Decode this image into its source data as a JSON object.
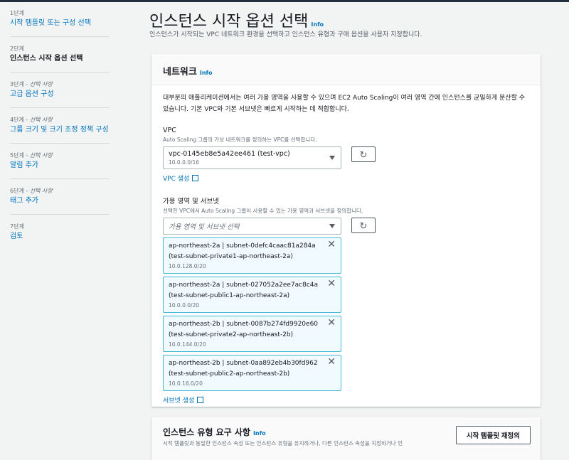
{
  "steps": [
    {
      "num": "1단계",
      "opt": "",
      "title": "시작 템플릿 또는 구성 선택"
    },
    {
      "num": "2단계",
      "opt": "",
      "title": "인스턴스 시작 옵션 선택"
    },
    {
      "num": "3단계",
      "opt": " - 선택 사항",
      "title": "고급 옵션 구성"
    },
    {
      "num": "4단계",
      "opt": " - 선택 사항",
      "title": "그룹 크기 및 크기 조정 정책 구성"
    },
    {
      "num": "5단계",
      "opt": " - 선택 사항",
      "title": "알림 추가"
    },
    {
      "num": "6단계",
      "opt": " - 선택 사항",
      "title": "태그 추가"
    },
    {
      "num": "7단계",
      "opt": "",
      "title": "검토"
    }
  ],
  "page": {
    "title": "인스턴스 시작 옵션 선택",
    "info": "Info",
    "desc": "인스턴스가 시작되는 VPC 네트워크 환경을 선택하고 인스턴스 유형과 구매 옵션을 사용자 지정합니다."
  },
  "network": {
    "title": "네트워크",
    "info": "Info",
    "desc": "대부분의 애플리케이션에서는 여러 가용 영역을 사용할 수 있으며 EC2 Auto Scaling이 여러 영역 간에 인스턴스를 균일하게 분산할 수 있습니다. 기본 VPC와 기본 서브넷은 빠르게 시작하는 데 적합합니다.",
    "vpc_label": "VPC",
    "vpc_hint": "Auto Scaling 그룹의 가상 네트워크를 정의하는 VPC를 선택합니다.",
    "vpc_value": "vpc-0145eb8e5a42ee461 (test-vpc)",
    "vpc_cidr": "10.0.0.0/16",
    "vpc_create": "VPC 생성",
    "az_label": "가용 영역 및 서브넷",
    "az_hint": "선택한 VPC에서 Auto Scaling 그룹이 사용할 수 있는 가용 영역과 서브넷을 정의합니다.",
    "az_placeholder": "가용 영역 및 서브넷 선택",
    "subnets": [
      {
        "line1": "ap-northeast-2a | subnet-0defc4caac81a284a",
        "line2": "(test-subnet-private1-ap-northeast-2a)",
        "cidr": "10.0.128.0/20"
      },
      {
        "line1": "ap-northeast-2a | subnet-027052a2ee7ac8c4a",
        "line2": "(test-subnet-public1-ap-northeast-2a)",
        "cidr": "10.0.0.0/20"
      },
      {
        "line1": "ap-northeast-2b | subnet-0087b274fd9920e60",
        "line2": "(test-subnet-private2-ap-northeast-2b)",
        "cidr": "10.0.144.0/20"
      },
      {
        "line1": "ap-northeast-2b | subnet-0aa892eb4b30fd962",
        "line2": "(test-subnet-public2-ap-northeast-2b)",
        "cidr": "10.0.16.0/20"
      }
    ],
    "subnet_create": "서브넷 생성"
  },
  "instance_req": {
    "title": "인스턴스 유형 요구 사항",
    "info": "Info",
    "desc": "시작 템플릿과 동일한 인스턴스 속성 또는 인스턴스 유형을 유지하거나, 다른 인스턴스 속성을 지정하거나 인",
    "button": "시작 템플릿 재정의"
  }
}
